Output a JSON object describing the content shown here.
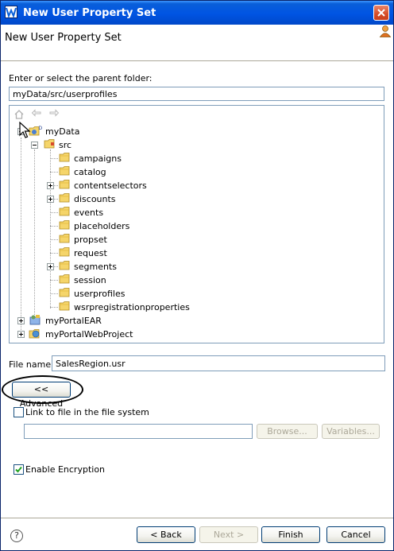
{
  "window": {
    "title": "New User Property Set"
  },
  "header": {
    "title": "New User Property Set"
  },
  "folder": {
    "label": "Enter or select the parent folder:",
    "value": "myData/src/userprofiles"
  },
  "tree": {
    "root": "myData",
    "src": "src",
    "src_children": [
      "campaigns",
      "catalog",
      "contentselectors",
      "discounts",
      "events",
      "placeholders",
      "propset",
      "request",
      "segments",
      "session",
      "userprofiles",
      "wsrpregistrationproperties"
    ],
    "projects": [
      "myPortalEAR",
      "myPortalWebProject"
    ]
  },
  "file": {
    "label": "File name:",
    "value": "SalesRegion.usr"
  },
  "advanced": {
    "label": "<< Advanced"
  },
  "link": {
    "label": "Link to file in the file system",
    "browse_label": "Browse...",
    "variables_label": "Variables..."
  },
  "encryption": {
    "label": "Enable Encryption",
    "checked": true
  },
  "buttons": {
    "back": "< Back",
    "next": "Next >",
    "finish": "Finish",
    "cancel": "Cancel"
  },
  "colors": {
    "titlebar": "#0054e3",
    "close": "#d64d28",
    "folder": "#f5c842"
  }
}
